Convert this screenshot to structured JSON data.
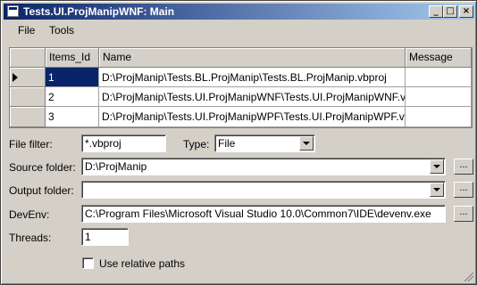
{
  "window": {
    "title": "Tests.UI.ProjManipWNF: Main",
    "buttons": {
      "minimize": "_",
      "maximize": "□",
      "close": "×"
    }
  },
  "menu": {
    "file": "File",
    "tools": "Tools"
  },
  "grid": {
    "columns": [
      "Items_Id",
      "Name",
      "Message"
    ],
    "rows": [
      {
        "id": "1",
        "name": "D:\\ProjManip\\Tests.BL.ProjManip\\Tests.BL.ProjManip.vbproj",
        "message": "",
        "current": true
      },
      {
        "id": "2",
        "name": "D:\\ProjManip\\Tests.UI.ProjManipWNF\\Tests.UI.ProjManipWNF.vbproj",
        "message": "",
        "current": false
      },
      {
        "id": "3",
        "name": "D:\\ProjManip\\Tests.UI.ProjManipWPF\\Tests.UI.ProjManipWPF.vbproj",
        "message": "",
        "current": false
      }
    ]
  },
  "form": {
    "file_filter_label": "File filter:",
    "file_filter_value": "*.vbproj",
    "type_label": "Type:",
    "type_value": "File",
    "source_folder_label": "Source folder:",
    "source_folder_value": "D:\\ProjManip",
    "output_folder_label": "Output folder:",
    "output_folder_value": "",
    "devenv_label": "DevEnv:",
    "devenv_value": "C:\\Program Files\\Microsoft Visual Studio 10.0\\Common7\\IDE\\devenv.exe",
    "threads_label": "Threads:",
    "threads_value": "1",
    "relative_paths_label": "Use relative paths",
    "relative_paths_checked": false,
    "browse_label": "..."
  },
  "colors": {
    "titlebar_start": "#0a246a",
    "titlebar_end": "#a6caf0",
    "window_face": "#d4d0c8",
    "selection": "#0a246a"
  },
  "icons": [
    "app-icon",
    "minimize-icon",
    "maximize-icon",
    "close-icon",
    "current-row-arrow-icon",
    "dropdown-arrow-icon",
    "size-grip-icon"
  ]
}
